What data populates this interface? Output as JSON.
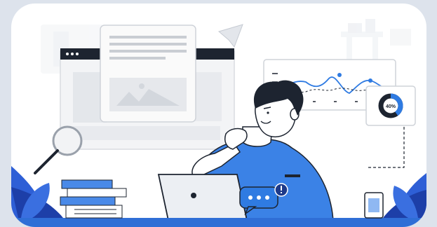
{
  "illustration": {
    "donut_label": "40%",
    "donut_fraction": 0.4,
    "colors": {
      "background": "#dde3ec",
      "card": "#ffffff",
      "accent_blue": "#2f7be2",
      "leaf_blue": "#2e5fd6",
      "outline": "#1d2430",
      "shirt": "#3b82e6",
      "skin": "#ffffff",
      "hair": "#1d2430"
    },
    "icons": [
      "browser-window-icon",
      "document-icon",
      "magnifier-icon",
      "line-chart-card-icon",
      "donut-chart-card-icon",
      "laptop-icon",
      "chat-bubble-icon",
      "alert-badge-icon",
      "book-stack-icon",
      "leaf-icon"
    ]
  }
}
